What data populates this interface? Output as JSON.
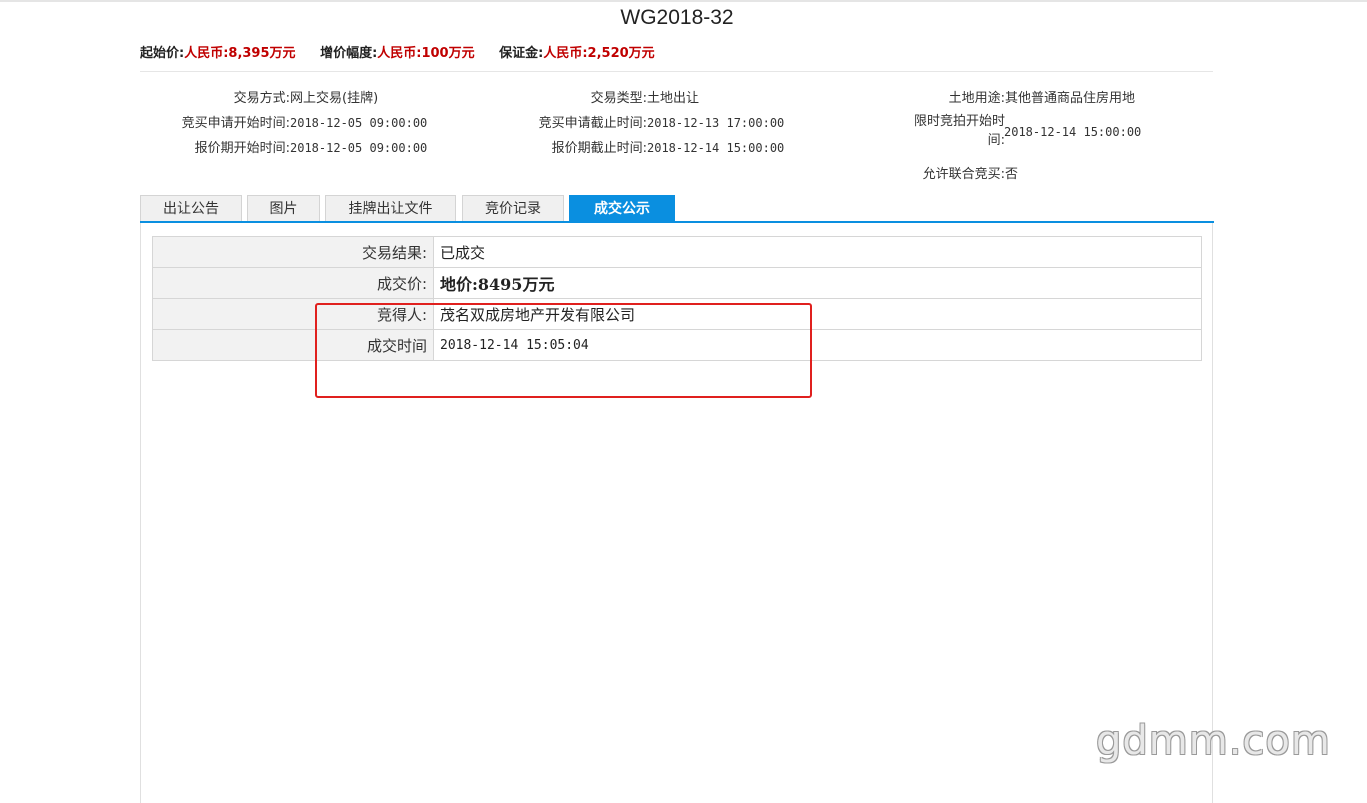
{
  "header": {
    "title": "WG2018-32",
    "start_price_label": "起始价:",
    "start_price": "人民币:8,395万元",
    "increment_label": "增价幅度:",
    "increment": "人民币:100万元",
    "deposit_label": "保证金:",
    "deposit": "人民币:2,520万元"
  },
  "info": {
    "trade_method_label": "交易方式:",
    "trade_method": "网上交易(挂牌)",
    "trade_type_label": "交易类型:",
    "trade_type": "土地出让",
    "land_use_label": "土地用途:",
    "land_use": "其他普通商品住房用地",
    "apply_start_label": "竞买申请开始时间:",
    "apply_start": "2018-12-05 09:00:00",
    "apply_end_label": "竞买申请截止时间:",
    "apply_end": "2018-12-13 17:00:00",
    "auction_start_label_1": "限时竞拍开始时",
    "auction_start_label_2": "间:",
    "auction_start": "2018-12-14 15:00:00",
    "quote_start_label": "报价期开始时间:",
    "quote_start": "2018-12-05 09:00:00",
    "quote_end_label": "报价期截止时间:",
    "quote_end": "2018-12-14 15:00:00",
    "joint_bid_label": "允许联合竞买:",
    "joint_bid": "否"
  },
  "tabs": [
    "出让公告",
    "图片",
    "挂牌出让文件",
    "竞价记录",
    "成交公示"
  ],
  "active_tab": "成交公示",
  "result": {
    "rows": [
      {
        "key": "交易结果:",
        "value": "已成交"
      },
      {
        "key": "成交价:",
        "value": "地价:8495万元"
      },
      {
        "key": "竞得人:",
        "value": "茂名双成房地产开发有限公司"
      },
      {
        "key": "成交时间",
        "value": "2018-12-14 15:05:04"
      }
    ]
  },
  "watermark": "gdmm.com",
  "colors": {
    "accent": "#0a8fe0",
    "price_red": "#c00000",
    "highlight_box": "#e0201e"
  }
}
